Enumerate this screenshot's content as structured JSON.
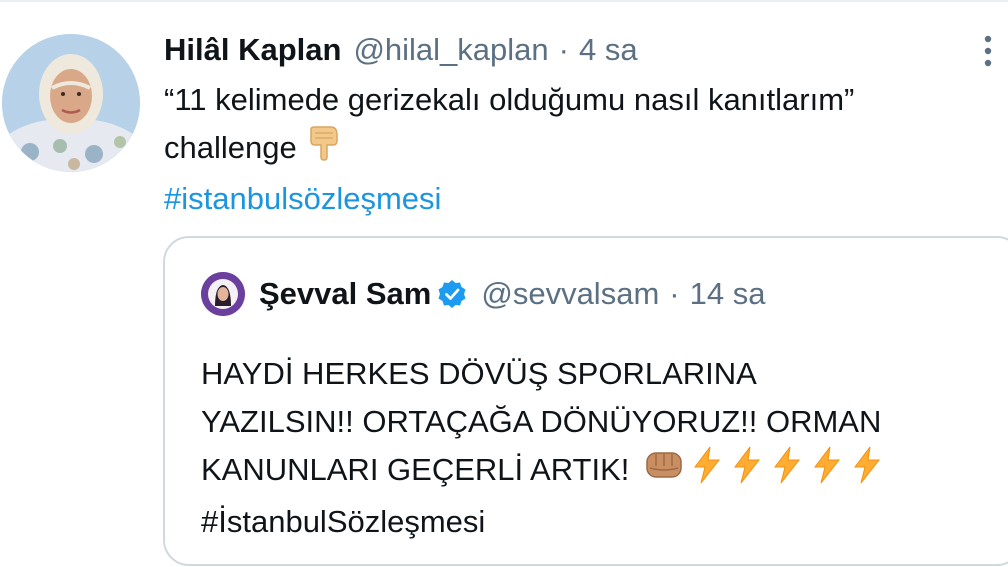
{
  "tweet": {
    "author_name": "Hilâl Kaplan",
    "author_handle": "@hilal_kaplan",
    "separator": "·",
    "time": "4 sa",
    "text_line1": "“11 kelimede gerizekalı olduğumu nasıl kanıtlarım”",
    "text_line2": "challenge",
    "hashtag": "#istanbulsözleşmesi",
    "emoji": "backhand-index-pointing-down"
  },
  "quote": {
    "author_name": "Şevval Sam",
    "author_handle": "@sevvalsam",
    "separator": "·",
    "time": "14 sa",
    "line1": "HAYDİ HERKES DÖVÜŞ SPORLARINA",
    "line2": "YAZILSIN!! ORTAÇAĞA DÖNÜYORUZ!! ORMAN",
    "line3": "KANUNLARI GEÇERLİ ARTIK!",
    "hashtag": "#İstanbulSözleşmesi",
    "emojis": [
      "oncoming-fist",
      "high-voltage",
      "high-voltage",
      "high-voltage",
      "high-voltage",
      "high-voltage"
    ],
    "verified": true
  },
  "colors": {
    "text": "#0f1419",
    "secondary": "#5b7083",
    "link": "#1b95e0",
    "border": "#cfd9de",
    "verified": "#1d9bf0"
  },
  "icons": {
    "more": "more-vertical-icon",
    "verified": "verified-badge-icon"
  }
}
